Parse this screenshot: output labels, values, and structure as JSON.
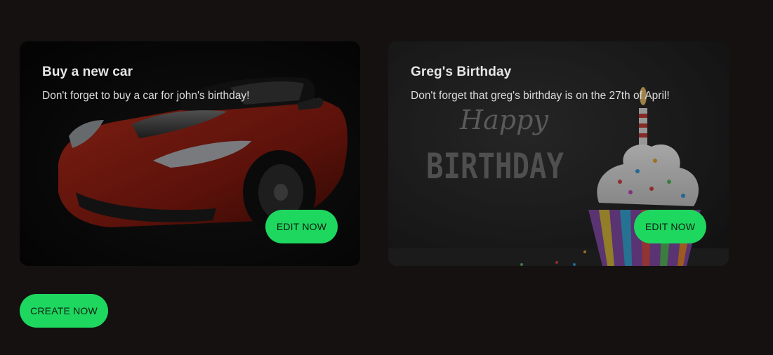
{
  "cards": [
    {
      "title": "Buy a new car",
      "description": "Don't forget to buy a car for john's birthday!",
      "button_label": "EDIT NOW",
      "image": "red-sports-car"
    },
    {
      "title": "Greg's Birthday",
      "description": "Don't forget that greg's birthday is on the 27th of April!",
      "button_label": "EDIT NOW",
      "image": "birthday-cupcake-chalkboard",
      "image_text": {
        "line1": "Happy",
        "line2": "BIRTHDAY"
      }
    }
  ],
  "create_button_label": "CREATE NOW",
  "colors": {
    "background": "#141110",
    "accent": "#1ed75f",
    "title": "#e6e6e6"
  }
}
